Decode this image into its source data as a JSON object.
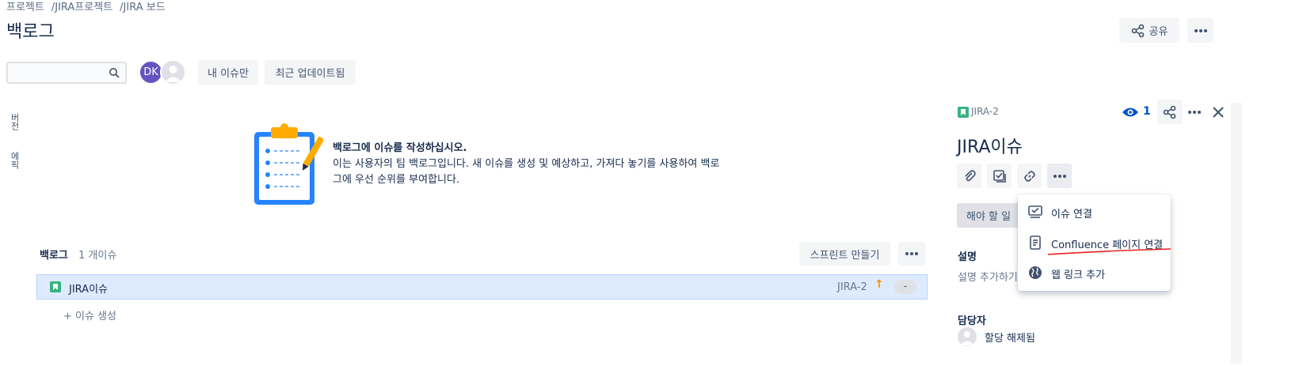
{
  "breadcrumbs": [
    "프로젝트",
    "JIRA프로젝트",
    "JIRA 보드"
  ],
  "page_title": "백로그",
  "header_actions": {
    "share_label": "공유"
  },
  "filters": {
    "search_placeholder": "",
    "avatar_initials": "DK",
    "only_my_issues": "내 이슈만",
    "recently_updated": "최근 업데이트됨"
  },
  "side_tabs": {
    "versions": "버전",
    "epics": "에픽"
  },
  "empty_state": {
    "heading": "백로그에 이슈를 작성하십시오.",
    "body": "이는 사용자의 팀 백로그입니다. 새 이슈를 생성 및 예상하고, 가져다 놓기를 사용하여 백로그에 우선 순위를 부여합니다."
  },
  "backlog": {
    "title": "백로그",
    "count": "1 개이슈",
    "create_sprint": "스프린트 만들기",
    "issues": [
      {
        "summary": "JIRA이슈",
        "key": "JIRA-2",
        "estimate": "-"
      }
    ],
    "create_issue": "+  이슈 생성"
  },
  "detail": {
    "issue_key": "JIRA-2",
    "watchers": "1",
    "title": "JIRA이슈",
    "status": "해야 할 일",
    "description_label": "설명",
    "description_placeholder": "설명 추가하기",
    "assignee_label": "담당자",
    "assignee_value": "할당 해제됨"
  },
  "link_menu": {
    "items": [
      {
        "label": "이슈 연결",
        "icon": "issue-link-icon"
      },
      {
        "label": "Confluence 페이지 연결",
        "icon": "confluence-page-icon"
      },
      {
        "label": "웹 링크 추가",
        "icon": "globe-icon"
      }
    ]
  },
  "colors": {
    "accent": "#0052cc",
    "story": "#36b37e",
    "selected_row": "#deebff",
    "annotation": "#e5241f"
  }
}
